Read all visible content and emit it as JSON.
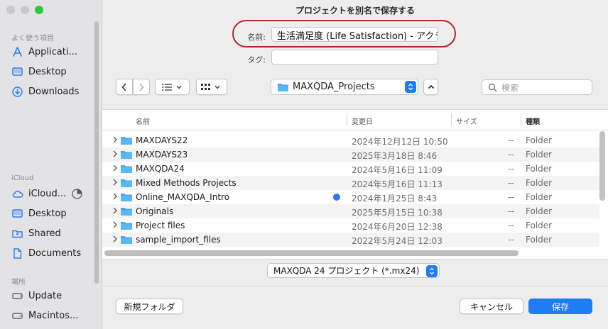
{
  "window": {
    "traffic_lights": [
      "close",
      "minimize",
      "maximize"
    ]
  },
  "sidebar": {
    "favorites_header": "よく使う項目",
    "favorites": [
      {
        "label": "Applicati...",
        "icon": "applications-icon"
      },
      {
        "label": "Desktop",
        "icon": "desktop-icon"
      },
      {
        "label": "Downloads",
        "icon": "downloads-icon"
      }
    ],
    "icloud_header": "iCloud",
    "icloud": [
      {
        "label": "iCloud...",
        "icon": "icloud-icon"
      },
      {
        "label": "Desktop",
        "icon": "desktop-icon"
      },
      {
        "label": "Shared",
        "icon": "shared-folder-icon"
      },
      {
        "label": "Documents",
        "icon": "document-icon"
      }
    ],
    "locations_header": "場所",
    "locations": [
      {
        "label": "Update",
        "icon": "disk-icon"
      },
      {
        "label": "Macintos...",
        "icon": "disk-icon"
      }
    ]
  },
  "dialog": {
    "title": "プロジェクトを別名で保存する",
    "name_label": "名前:",
    "name_value": "生活満足度 (Life Satisfaction) - アクラ",
    "tags_label": "タグ:",
    "tags_value": "",
    "current_folder": "MAXQDA_Projects",
    "search_placeholder": "検索",
    "accent_color": "#1e7cf5",
    "highlight_color": "#b5252b"
  },
  "filelist": {
    "columns": {
      "name": "名前",
      "date": "変更日",
      "size": "サイズ",
      "kind": "種類"
    },
    "rows": [
      {
        "name": "MAXDAYS22",
        "date": "2024年12月12日 10:50",
        "size": "--",
        "kind": "Folder",
        "tag": false
      },
      {
        "name": "MAXDAYS23",
        "date": "2025年3月18日 8:46",
        "size": "--",
        "kind": "Folder",
        "tag": false
      },
      {
        "name": "MAXQDA24",
        "date": "2024年5月16日 11:09",
        "size": "--",
        "kind": "Folder",
        "tag": false
      },
      {
        "name": "Mixed Methods Projects",
        "date": "2024年5月16日 11:13",
        "size": "--",
        "kind": "Folder",
        "tag": false
      },
      {
        "name": "Online_MAXQDA_Intro",
        "date": "2024年1月25日 8:43",
        "size": "--",
        "kind": "Folder",
        "tag": true
      },
      {
        "name": "Originals",
        "date": "2025年5月15日 10:38",
        "size": "--",
        "kind": "Folder",
        "tag": false
      },
      {
        "name": "Project files",
        "date": "2024年6月20日 12:38",
        "size": "--",
        "kind": "Folder",
        "tag": false
      },
      {
        "name": "sample_import_files",
        "date": "2022年5月24日 12:03",
        "size": "--",
        "kind": "Folder",
        "tag": false
      }
    ]
  },
  "format": {
    "selected": "MAXQDA 24 プロジェクト (*.mx24)"
  },
  "buttons": {
    "new_folder": "新規フォルダ",
    "cancel": "キャンセル",
    "save": "保存"
  }
}
